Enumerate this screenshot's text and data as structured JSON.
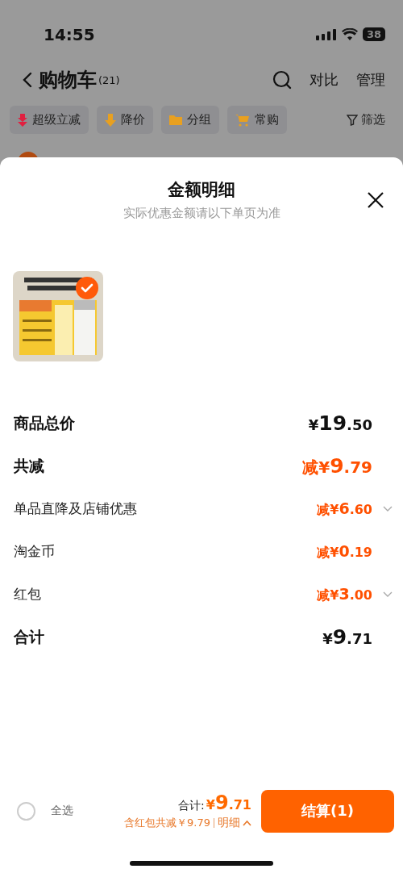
{
  "status_bar": {
    "time": "14:55",
    "battery": "38"
  },
  "header": {
    "title": "购物车",
    "count": "(21)",
    "actions": [
      "对比",
      "管理"
    ]
  },
  "chips": [
    {
      "label": "超级立减",
      "kind": "down"
    },
    {
      "label": "降价",
      "kind": "price"
    },
    {
      "label": "分组",
      "kind": "folder"
    },
    {
      "label": "常购",
      "kind": "cart"
    }
  ],
  "filter": "筛选",
  "sheet": {
    "title": "金额明细",
    "subtitle": "实际优惠金额请以下单页为准",
    "items": [
      {
        "kind": "picture",
        "checked": true
      }
    ],
    "rows": [
      {
        "label": "商品总价",
        "kind": "total",
        "prefix": "¥",
        "main": "19",
        "fraction": ".50",
        "expandable": false
      },
      {
        "label": "共减",
        "kind": "discount",
        "prefix": "减¥",
        "main": "9",
        "fraction": ".79",
        "expandable": false
      },
      {
        "label": "单品直降及店铺优惠",
        "kind": "detail",
        "prefix": "减¥",
        "main": "6",
        "fraction": ".60",
        "expandable": true
      },
      {
        "label": "淘金币",
        "kind": "detail",
        "prefix": "减¥",
        "main": "0",
        "fraction": ".19",
        "expandable": false
      },
      {
        "label": "红包",
        "kind": "detail",
        "prefix": "减¥",
        "main": "3",
        "fraction": ".00",
        "expandable": true
      },
      {
        "label": "合计",
        "kind": "total",
        "prefix": "¥",
        "main": "9",
        "fraction": ".71",
        "expandable": false
      }
    ]
  },
  "footer": {
    "select_all": {
      "label": "全选",
      "checked": false
    },
    "total_label": "合计:",
    "total_prefix": "¥",
    "total_main": "9",
    "total_fraction": ".71",
    "discount_note": "含红包共减￥9.79",
    "detail_link": "明细",
    "expanded": true,
    "checkout": "结算(1)"
  }
}
